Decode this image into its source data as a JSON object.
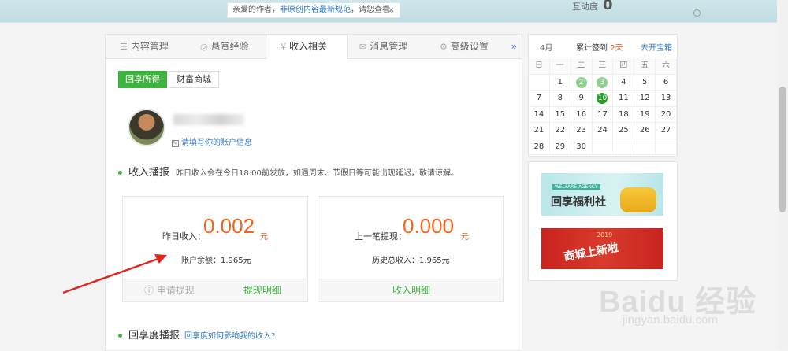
{
  "notice": {
    "text_prefix": "亲爱的作者，",
    "link": "非原创内容最新规范",
    "text_suffix": "，请您查看。",
    "close": "×"
  },
  "header": {
    "hudong_label": "互动度",
    "hudong_value": "0"
  },
  "tabs": [
    {
      "icon": "list-icon",
      "label": "内容管理"
    },
    {
      "icon": "coin-icon",
      "label": "悬赏经验"
    },
    {
      "icon": "yen-icon",
      "label": "收入相关",
      "active": true
    },
    {
      "icon": "mail-icon",
      "label": "消息管理"
    },
    {
      "icon": "gear-icon",
      "label": "高级设置"
    }
  ],
  "tab_more": "»",
  "subtabs": {
    "active": "回享所得",
    "other": "财富商城"
  },
  "profile": {
    "fill_info": "请填写你的账户信息"
  },
  "income_broadcast": {
    "title": "收入播报",
    "note": "昨日收入会在今日18:00前发放，如遇周末、节假日等可能出现延迟，敬请谅解。"
  },
  "card_left": {
    "label": "昨日收入：",
    "value": "0.002",
    "unit": "元",
    "sub": "账户余额：1.965元",
    "btn_apply": "申请提现",
    "btn_detail": "提现明细"
  },
  "card_right": {
    "label": "上一笔提现：",
    "value": "0.000",
    "unit": "元",
    "sub": "历史总收入：1.965元",
    "btn_detail": "收入明细"
  },
  "share_broadcast": {
    "title": "回享度播报",
    "link": "回享度如何影响我的收入?"
  },
  "calendar": {
    "month": "4月",
    "sign_prefix": "累计签到",
    "sign_days": "2天",
    "open_box": "去开宝箱",
    "weekdays": [
      "日",
      "一",
      "二",
      "三",
      "四",
      "五",
      "六"
    ],
    "rows": [
      [
        "",
        "1",
        "2",
        "3",
        "4",
        "5",
        "6"
      ],
      [
        "7",
        "8",
        "9",
        "10",
        "11",
        "12",
        "13"
      ],
      [
        "14",
        "15",
        "16",
        "17",
        "18",
        "19",
        "20"
      ],
      [
        "21",
        "22",
        "23",
        "24",
        "25",
        "26",
        "27"
      ],
      [
        "28",
        "29",
        "30",
        "",
        "",
        "",
        ""
      ]
    ],
    "signed": [
      "2",
      "3"
    ],
    "today": "10"
  },
  "banners": {
    "welfare_tag": "WELFARE AGENCY",
    "welfare_title": "回享福利社",
    "mall_year": "2019",
    "mall_title": "商城上新啦"
  },
  "watermark": {
    "brand": "Baidu 经验",
    "url": "jingyan.baidu.com"
  },
  "colors": {
    "accent_green": "#3fb33f",
    "accent_orange": "#f3641f",
    "link_blue": "#2f78c0"
  }
}
